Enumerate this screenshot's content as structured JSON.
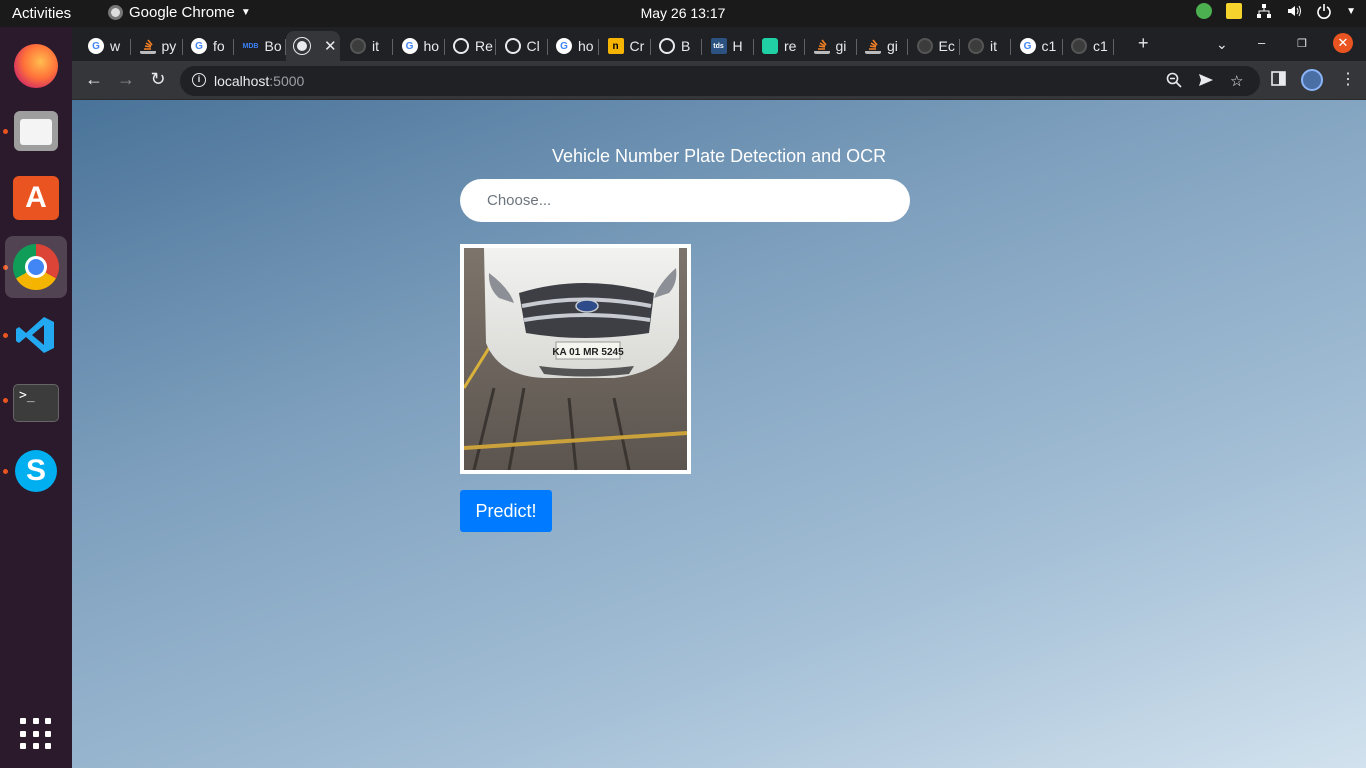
{
  "system": {
    "activities": "Activities",
    "app_name": "Google Chrome",
    "clock": "May 26  13:17"
  },
  "dock": {
    "items": [
      "firefox-icon",
      "files-icon",
      "app-store-icon",
      "chrome-icon",
      "vscode-icon",
      "terminal-icon",
      "skype-icon",
      "app-grid-icon"
    ],
    "terminal_text": ">_",
    "store_glyph": "A",
    "skype_glyph": "S"
  },
  "browser": {
    "tabs": [
      {
        "label": "w",
        "favicon": "google"
      },
      {
        "label": "py",
        "favicon": "stackoverflow"
      },
      {
        "label": "fo",
        "favicon": "google"
      },
      {
        "label": "Bo",
        "favicon": "mdb"
      },
      {
        "label": "",
        "favicon": "globe",
        "active": true
      },
      {
        "label": "it",
        "favicon": "github-dim"
      },
      {
        "label": "ho",
        "favicon": "google"
      },
      {
        "label": "Re",
        "favicon": "github"
      },
      {
        "label": "Cl",
        "favicon": "github"
      },
      {
        "label": "ho",
        "favicon": "google"
      },
      {
        "label": "Cr",
        "favicon": "n"
      },
      {
        "label": "B",
        "favicon": "github"
      },
      {
        "label": "H",
        "favicon": "tds"
      },
      {
        "label": "re",
        "favicon": "green"
      },
      {
        "label": "gi",
        "favicon": "stackoverflow"
      },
      {
        "label": "gi",
        "favicon": "stackoverflow"
      },
      {
        "label": "Ec",
        "favicon": "github-dim"
      },
      {
        "label": "it",
        "favicon": "github-dim"
      },
      {
        "label": "c1",
        "favicon": "google"
      },
      {
        "label": "c1",
        "favicon": "github-dim"
      }
    ],
    "mdb_text": "MDB",
    "tds_text": "tds",
    "n_text": "n",
    "url_host": "localhost",
    "url_port": ":5000"
  },
  "page": {
    "title": "Vehicle Number Plate Detection and OCR",
    "file_input_placeholder": "Choose...",
    "plate_text": "KA 01 MR 5245",
    "predict_label": "Predict!"
  },
  "colors": {
    "accent": "#007bff",
    "gradient_start": "#4a7399",
    "gradient_end": "#d2e2ee"
  }
}
